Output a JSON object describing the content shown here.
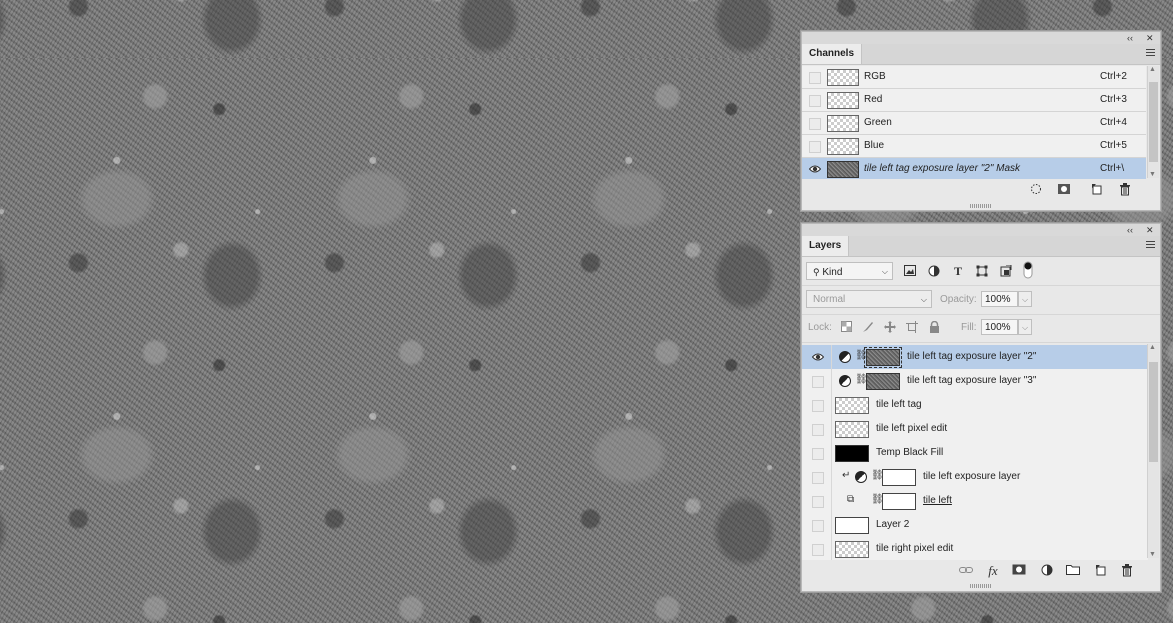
{
  "channels_panel": {
    "tab_label": "Channels",
    "collapse_glyph": "‹‹",
    "close_glyph": "✕",
    "rows": [
      {
        "name": "RGB",
        "shortcut": "Ctrl+2",
        "visible": false,
        "selected": false,
        "thumb": "checker"
      },
      {
        "name": "Red",
        "shortcut": "Ctrl+3",
        "visible": false,
        "selected": false,
        "thumb": "checker"
      },
      {
        "name": "Green",
        "shortcut": "Ctrl+4",
        "visible": false,
        "selected": false,
        "thumb": "checker"
      },
      {
        "name": "Blue",
        "shortcut": "Ctrl+5",
        "visible": false,
        "selected": false,
        "thumb": "checker"
      },
      {
        "name": "tile left tag exposure layer \"2\" Mask",
        "shortcut": "Ctrl+\\",
        "visible": true,
        "selected": true,
        "thumb": "noise"
      }
    ],
    "footer_icons": [
      "load-selection-icon",
      "save-selection-icon",
      "new-channel-icon",
      "trash-icon"
    ]
  },
  "layers_panel": {
    "tab_label": "Layers",
    "collapse_glyph": "‹‹",
    "close_glyph": "✕",
    "filter_kind": "Kind",
    "filter_icons": [
      "image-filter-icon",
      "adjustment-filter-icon",
      "type-filter-icon",
      "shape-filter-icon",
      "smart-object-filter-icon",
      "filter-toggle-icon"
    ],
    "blend_mode": "Normal",
    "opacity_label": "Opacity:",
    "opacity_value": "100%",
    "lock_label": "Lock:",
    "fill_label": "Fill:",
    "fill_value": "100%",
    "layers": [
      {
        "name": "tile left tag exposure layer \"2\"",
        "type": "adjustment",
        "visible": true,
        "selected": true,
        "thumb": "noise",
        "clipped": false
      },
      {
        "name": "tile left tag exposure layer \"3\"",
        "type": "adjustment",
        "visible": false,
        "selected": false,
        "thumb": "noise",
        "clipped": false
      },
      {
        "name": "tile left tag",
        "type": "pixel",
        "visible": false,
        "selected": false,
        "thumb": "checker"
      },
      {
        "name": "tile left pixel edit",
        "type": "pixel",
        "visible": false,
        "selected": false,
        "thumb": "checker"
      },
      {
        "name": "Temp Black Fill",
        "type": "pixel",
        "visible": false,
        "selected": false,
        "thumb": "black"
      },
      {
        "name": "tile left exposure layer",
        "type": "adjustment",
        "visible": false,
        "selected": false,
        "thumb": "white",
        "clipped": true
      },
      {
        "name": "tile left",
        "type": "smart",
        "visible": false,
        "selected": false,
        "thumb": "white",
        "underline": true
      },
      {
        "name": "Layer 2",
        "type": "pixel",
        "visible": false,
        "selected": false,
        "thumb": "white"
      },
      {
        "name": "tile right pixel edit",
        "type": "pixel",
        "visible": false,
        "selected": false,
        "thumb": "checker"
      }
    ],
    "footer_icons": [
      "link-icon",
      "fx-icon",
      "mask-icon",
      "adjustment-icon",
      "folder-icon",
      "new-layer-icon",
      "trash-icon"
    ],
    "fx_label": "fx"
  }
}
